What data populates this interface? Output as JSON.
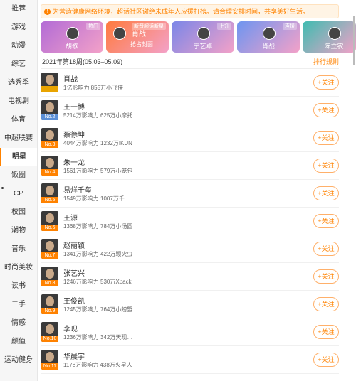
{
  "sidebar": {
    "items": [
      "推荐",
      "游戏",
      "动漫",
      "综艺",
      "选秀季",
      "电视剧",
      "体育",
      "中超联赛",
      "明星",
      "饭圈",
      "CP",
      "校园",
      "潮物",
      "音乐",
      "时尚美妆",
      "读书",
      "二手",
      "情感",
      "颜值",
      "运动健身"
    ],
    "active_index": 8
  },
  "notice": {
    "icon": "warning-icon",
    "text": "为营造健康网络环境，超话社区谢绝未成年人应援打榜。请合理安排时间，共享美好生活。"
  },
  "banners": [
    {
      "name": "胡歌",
      "tag": "热门",
      "color": "#b26bd6"
    },
    {
      "name": "肖战",
      "tag": "新晋超话新星",
      "sub": "抢占封面",
      "color": "#ff7a3d"
    },
    {
      "name": "宁艺卓",
      "tag": "上升",
      "color": "#7a86e8"
    },
    {
      "name": "肖战",
      "tag": "声援",
      "color": "#6e95f0"
    },
    {
      "name": "陈立农",
      "tag": "",
      "color": "#3ebcb0"
    }
  ],
  "period": "2021年第18周(05.03–05.09)",
  "rules_label": "排行规则",
  "follow_label": "+关注",
  "list": [
    {
      "name": "肖战",
      "rank": "",
      "stats": "1亿影响力 855万小飞侠",
      "badge": "gold"
    },
    {
      "name": "王一博",
      "rank": "No.2",
      "stats": "5214万影响力 625万小摩托",
      "badge": "blue"
    },
    {
      "name": "蔡徐坤",
      "rank": "No.3",
      "stats": "4044万影响力 1232万IKUN",
      "badge": "orange"
    },
    {
      "name": "朱一龙",
      "rank": "No.4",
      "stats": "1561万影响力 579万小笼包",
      "badge": "orange"
    },
    {
      "name": "易烊千玺",
      "rank": "No.5",
      "stats": "1549万影响力 1007万千…",
      "badge": "orange"
    },
    {
      "name": "王源",
      "rank": "No.6",
      "stats": "1368万影响力 784万小汤圆",
      "badge": "orange"
    },
    {
      "name": "赵丽颖",
      "rank": "No.7",
      "stats": "1341万影响力 422万颖火虫",
      "badge": "orange"
    },
    {
      "name": "张艺兴",
      "rank": "No.8",
      "stats": "1246万影响力 530万Xback",
      "badge": "orange"
    },
    {
      "name": "王俊凯",
      "rank": "No.9",
      "stats": "1245万影响力 764万小螃蟹",
      "badge": "orange"
    },
    {
      "name": "李现",
      "rank": "No.10",
      "stats": "1236万影响力 342万天现…",
      "badge": "orange"
    },
    {
      "name": "华晨宇",
      "rank": "No.11",
      "stats": "1178万影响力 438万火星人",
      "badge": "orange"
    }
  ]
}
